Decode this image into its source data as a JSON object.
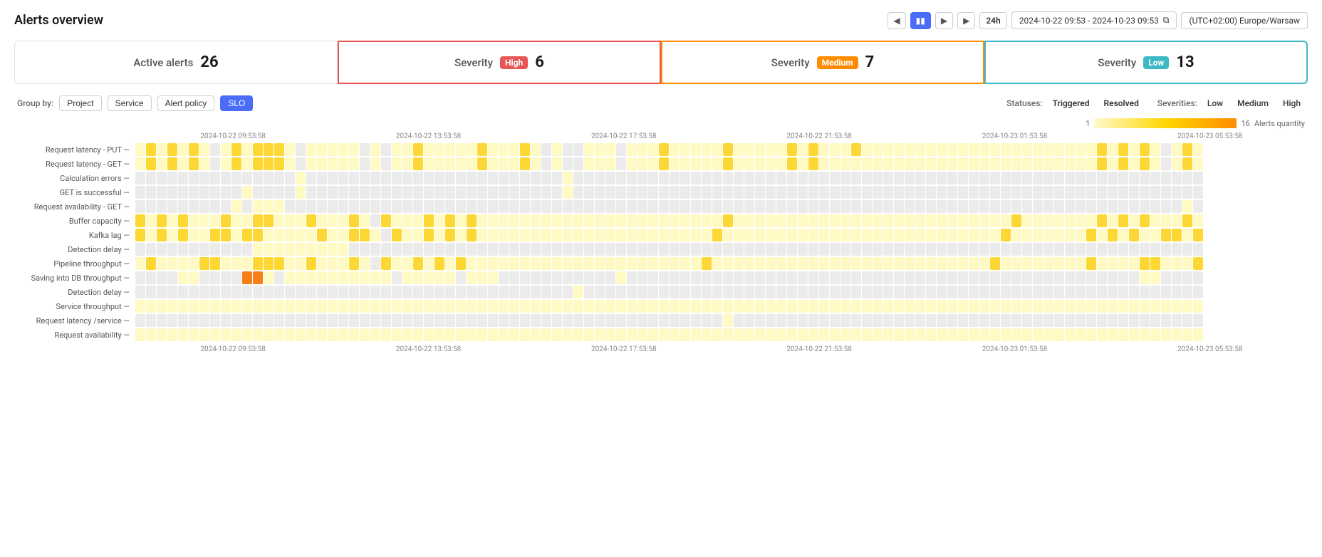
{
  "page": {
    "title": "Alerts overview"
  },
  "timeControls": {
    "prevLabel": "◀",
    "pauseLabel": "⏸",
    "playLabel": "▶",
    "nextLabel": "▶",
    "duration": "24h",
    "range": "2024-10-22 09:53 - 2024-10-23 09:53",
    "copyIcon": "⧉",
    "timezone": "(UTC+02:00) Europe/Warsaw"
  },
  "summaryCards": [
    {
      "id": "active-alerts",
      "label": "Active alerts",
      "count": "26",
      "badge": null,
      "type": "active"
    },
    {
      "id": "severity-high",
      "label": "Severity",
      "count": "6",
      "badge": "High",
      "badgeClass": "badge-high",
      "type": "high"
    },
    {
      "id": "severity-medium",
      "label": "Severity",
      "count": "7",
      "badge": "Medium",
      "badgeClass": "badge-medium",
      "type": "medium"
    },
    {
      "id": "severity-low",
      "label": "Severity",
      "count": "13",
      "badge": "Low",
      "badgeClass": "badge-low",
      "type": "low"
    }
  ],
  "groupBy": {
    "label": "Group by:",
    "options": [
      "Project",
      "Service",
      "Alert policy",
      "SLO"
    ],
    "active": "SLO"
  },
  "statuses": {
    "label": "Statuses:",
    "options": [
      "Triggered",
      "Resolved"
    ]
  },
  "severities": {
    "label": "Severities:",
    "options": [
      "Low",
      "Medium",
      "High"
    ]
  },
  "legend": {
    "min": "1",
    "max": "16",
    "label": "Alerts quantity"
  },
  "timeLabels": [
    "2024-10-22 09:53:58",
    "2024-10-22 13:53:58",
    "2024-10-22 17:53:58",
    "2024-10-22 21:53:58",
    "2024-10-23 01:53:58",
    "2024-10-23 05:53:58"
  ],
  "rows": [
    {
      "label": "Request latency - PUT —",
      "pattern": "lmlmlmlnlmlmmmlnlllllnlnllmlllllmlllmlnlnnlllnlllmlllllmlllllmlmlllmlllllllllllllllllllll"
    },
    {
      "label": "Request latency - GET —",
      "pattern": "lmlmlmlnlmlmmmlnlllllnlnllmlllllmlllmlnlnnlllnlllmlllllmlllllmlmlllllllllllllllllllllllll"
    },
    {
      "label": "Calculation errors —",
      "pattern": "nnnnnnnnnnnnnnnlnnnnnnnnnnnnnnnnnnnnnnnnlnnnnnnnnnnnnnnnnnnnnnnnnnnnnnnnnnnnnnnnnnnnnnnnnn"
    },
    {
      "label": "GET is successful —",
      "pattern": "nnnnnnnnnnlnnnnlnnnnnnnnnnnnnnnnnnnnnnnnlnnnnnnnnnnnnnnnnnnnnnnnnnnnnnnnnnnnnnnnnnnnnnnnnn"
    },
    {
      "label": "Request availability - GET —",
      "pattern": "nnnnnnnnnlnlllnnnnnnnnnnnnnnnnnnnnnnnnnnnnnnnnnnnnnnnnnnnnnnnnnnnnnnnnnnnnnnnnnnnnnnnnnnn"
    },
    {
      "label": "Buffer capacity —",
      "pattern": "mlmlmlllmllmmlllmlllmlnmlllmlmlmlllllllllllllllllllllllmllllllllllllllllllllllllllmlllllll"
    },
    {
      "label": "Kafka lag —",
      "pattern": "mlmlmllmmlmmlllllmllmmlnmllmlmlmllllllllllllllllllllllmllllllllllllllllllllllllllmlllllll"
    },
    {
      "label": "Detection delay —",
      "pattern": "nnnnnnnnnnnlllllllllnnnnnnnnnnnnnnnnnnnnnnnnnnnnnnnnnnnnnnnnnnnnnnnnnnnnnnnnnnnnnnnnnnnnn"
    },
    {
      "label": "Pipeline throughput —",
      "pattern": "lmllllmmlllmmmllmlllmlnmllmlmlmllllllllllllllllllllllmllllllllllllllllllllllllllmlllllll"
    },
    {
      "label": "Saving into DB throughput —",
      "pattern": "nnnnllnnnnhhlnllllllllllnlllllnlllnnnnnnnnnnnlnnnnnnnnnnnnnnnnnnnnnnnnnnnnnnnnnnnnnnnnnnnn"
    },
    {
      "label": "Detection delay —",
      "pattern": "nnnnnnnnnnnnnnnnnnnnnnnnnnnnnnnnnnnnnnnnnlnnnnnnnnnnnnnnnnnnnnnnnnnnnnnnnnnnnnnnnnnnnnnnnn"
    },
    {
      "label": "Service throughput —",
      "pattern": "lllllllllllllllllllllllllllllllllllllllllllllllllllllllllllllllllllllllllllllllllllllllll"
    },
    {
      "label": "Request latency /service —",
      "pattern": "nnnnnnnnnnnnnnnnnnnnnnnnnnnnnnnnnnnnnnnnnnnnnnnnnnnnnnnlnnnnnnnnnnnnnnnnnnnnnnnnnnnnnnnnn"
    },
    {
      "label": "Request availability —",
      "pattern": "lllllllllllllllllllllllllllllllllllllllllllllllllllllllllllllllllllllllllllllllllllllllll"
    }
  ]
}
